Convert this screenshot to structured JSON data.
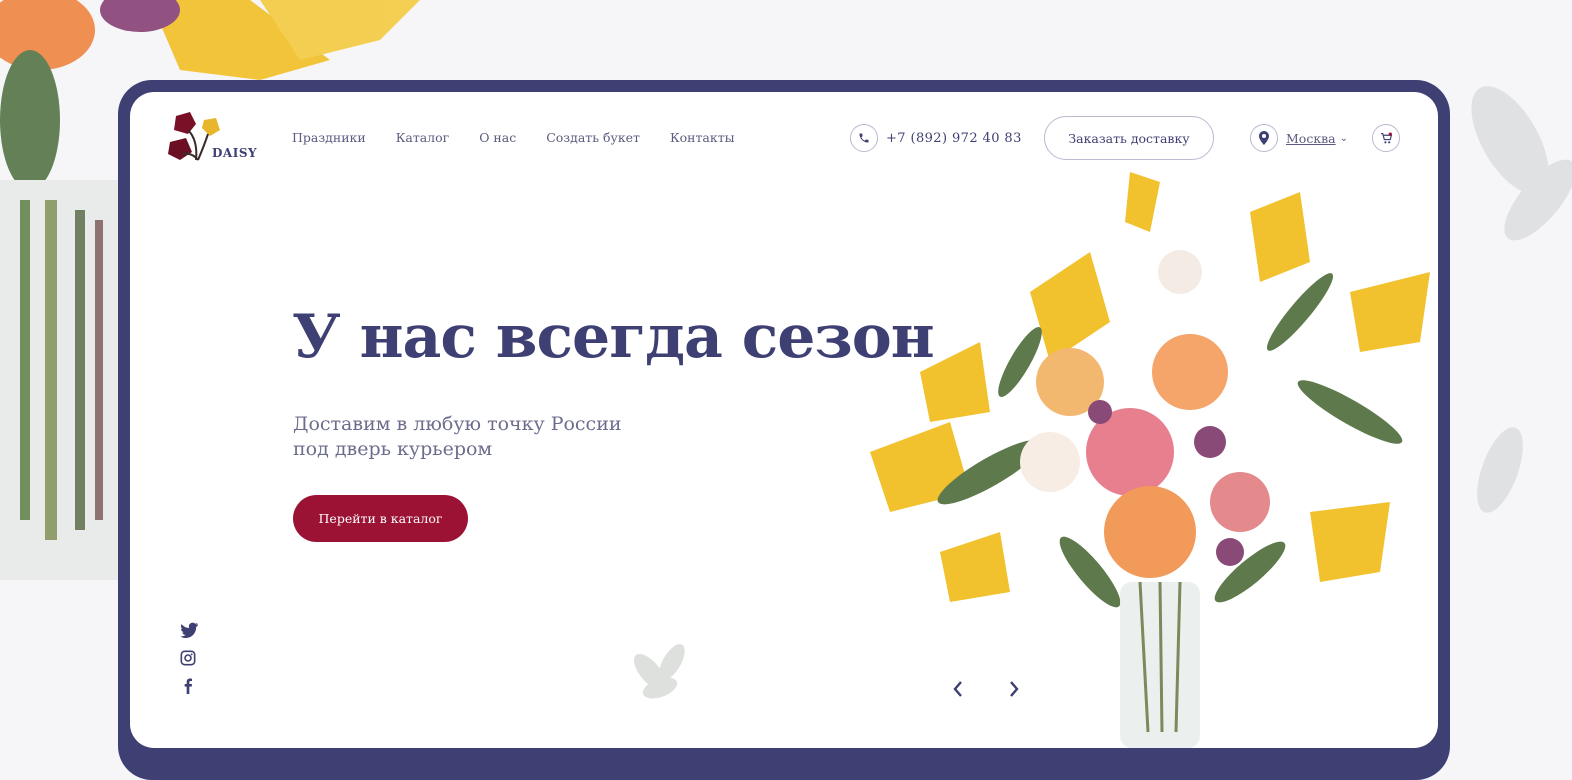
{
  "brand": {
    "name": "DAISY"
  },
  "nav": {
    "items": [
      "Праздники",
      "Каталог",
      "О нас",
      "Создать букет",
      "Контакты"
    ]
  },
  "header": {
    "phone": "+7 (892) 972 40 83",
    "order_button": "Заказать доставку",
    "city": "Москва"
  },
  "hero": {
    "title": "У нас всегда сезон",
    "subtitle_line1": "Доставим в любую точку России",
    "subtitle_line2": "под дверь курьером",
    "cta": "Перейти в каталог"
  },
  "colors": {
    "primary": "#3e3f72",
    "accent": "#9b1234",
    "text_muted": "#6c6d8c"
  },
  "icons": [
    "phone-icon",
    "location-icon",
    "chevron-down-icon",
    "cart-icon",
    "twitter-icon",
    "instagram-icon",
    "facebook-icon",
    "arrow-left-icon",
    "arrow-right-icon"
  ]
}
